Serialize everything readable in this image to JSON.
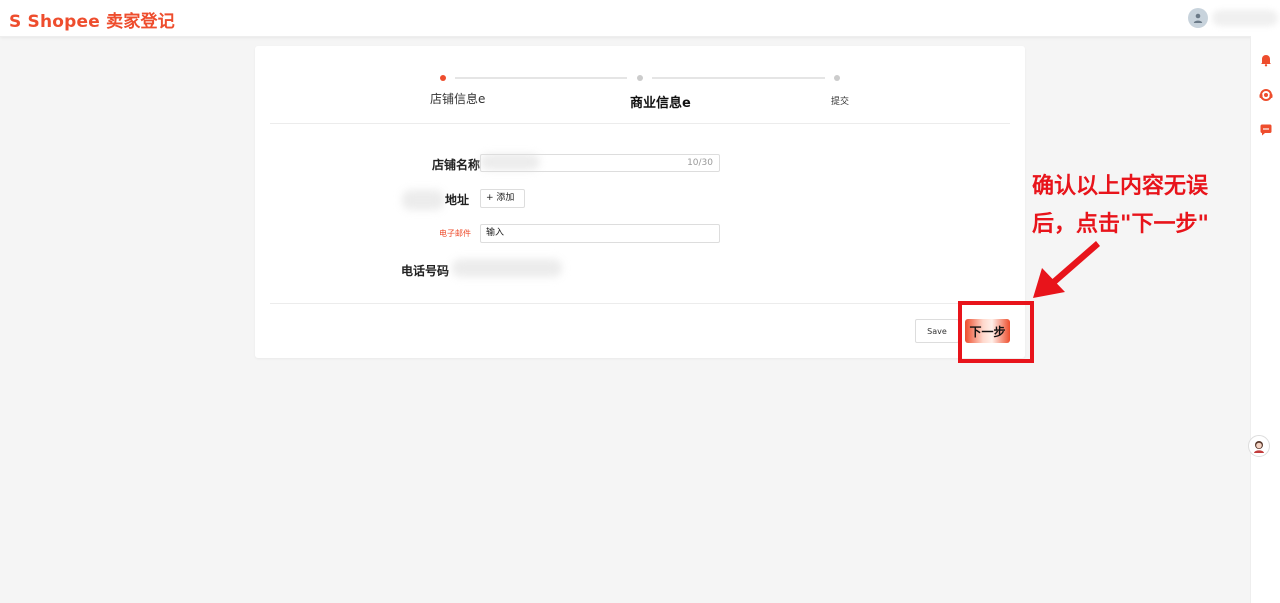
{
  "header": {
    "logo_text": "S Shopee 卖家登记"
  },
  "stepper": {
    "steps": [
      {
        "label": "店铺信息e",
        "active": true
      },
      {
        "label": "商业信息e",
        "active": false
      },
      {
        "label": "提交",
        "active": false
      }
    ]
  },
  "form": {
    "shop_name": {
      "label": "店铺名称",
      "count": "10/30"
    },
    "address": {
      "label": "地址",
      "button": "+ 添加"
    },
    "email": {
      "label": "电子邮件",
      "value": "输入"
    },
    "phone": {
      "label": "电话号码"
    }
  },
  "actions": {
    "save_label": "Save",
    "next_label": "下一步"
  },
  "annotation": {
    "line1": "确认以上内容无误",
    "line2": "后，点击\"下一步\""
  },
  "colors": {
    "brand": "#ee4d2d",
    "annotation": "#e8141b"
  }
}
